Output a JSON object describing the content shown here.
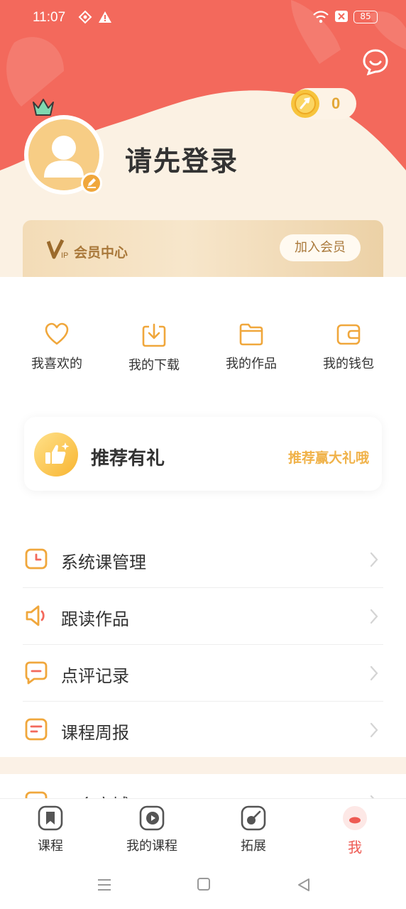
{
  "status_bar": {
    "time": "11:07",
    "battery": "85"
  },
  "header": {
    "coins": "0",
    "login_prompt": "请先登录",
    "icons": [
      "chat-icon",
      "coin-icon",
      "crown-icon",
      "edit-icon",
      "avatar-placeholder"
    ]
  },
  "vip": {
    "label": "会员中心",
    "join_button": "加入会员",
    "logo_text": "VIP"
  },
  "quick_actions": [
    {
      "label": "我喜欢的",
      "icon": "heart-icon"
    },
    {
      "label": "我的下载",
      "icon": "download-icon"
    },
    {
      "label": "我的作品",
      "icon": "folder-icon"
    },
    {
      "label": "我的钱包",
      "icon": "wallet-icon"
    }
  ],
  "promo": {
    "title": "推荐有礼",
    "link": "推荐赢大礼哦",
    "icon": "thumbs-up-icon"
  },
  "menu": [
    {
      "label": "系统课管理",
      "icon": "clock-calendar-icon"
    },
    {
      "label": "跟读作品",
      "icon": "speaker-icon"
    },
    {
      "label": "点评记录",
      "icon": "comment-icon"
    },
    {
      "label": "课程周报",
      "icon": "report-icon"
    }
  ],
  "menu_partial": {
    "label": "工会商城"
  },
  "tabs": [
    {
      "label": "课程",
      "active": false,
      "icon": "bookmark-icon"
    },
    {
      "label": "我的课程",
      "active": false,
      "icon": "play-icon"
    },
    {
      "label": "拓展",
      "active": false,
      "icon": "explore-icon"
    },
    {
      "label": "我",
      "active": true,
      "icon": "me-icon"
    }
  ],
  "colors": {
    "accent": "#f3695c",
    "gold": "#f0a73c",
    "active_tab": "#ee5a53",
    "cream": "#fbf1e3"
  }
}
